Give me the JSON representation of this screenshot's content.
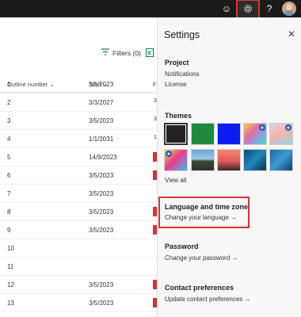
{
  "topbar": {
    "icons": [
      "smiley-icon",
      "gear-icon",
      "help-icon",
      "avatar"
    ],
    "help_label": "?",
    "smiley_label": "☺"
  },
  "grid": {
    "filters_label": "Filters (0)",
    "columns": [
      "Outline number",
      "Start",
      "F"
    ],
    "rows": [
      {
        "num": "1",
        "start": "3/5/2023",
        "extra": "",
        "flag": false
      },
      {
        "num": "2",
        "start": "3/3/2027",
        "extra": "3",
        "flag": false
      },
      {
        "num": "3",
        "start": "3/5/2023",
        "extra": "3",
        "flag": false
      },
      {
        "num": "4",
        "start": "1/1/2031",
        "extra": "1",
        "flag": false
      },
      {
        "num": "5",
        "start": "14/9/2023",
        "extra": "",
        "flag": true
      },
      {
        "num": "6",
        "start": "3/5/2023",
        "extra": "",
        "flag": true
      },
      {
        "num": "7",
        "start": "3/5/2023",
        "extra": "",
        "flag": false
      },
      {
        "num": "8",
        "start": "3/5/2023",
        "extra": "",
        "flag": true
      },
      {
        "num": "9",
        "start": "3/5/2023",
        "extra": "",
        "flag": true
      },
      {
        "num": "10",
        "start": "",
        "extra": "",
        "flag": false
      },
      {
        "num": "11",
        "start": "",
        "extra": "",
        "flag": false
      },
      {
        "num": "12",
        "start": "3/5/2023",
        "extra": "",
        "flag": true
      },
      {
        "num": "13",
        "start": "3/5/2023",
        "extra": "",
        "flag": true
      }
    ]
  },
  "settings": {
    "title": "Settings",
    "project": {
      "title": "Project",
      "items": [
        "Notifications",
        "License"
      ]
    },
    "themes": {
      "title": "Themes",
      "view_all": "View all"
    },
    "language": {
      "title": "Language and time zone",
      "link": "Change your language →"
    },
    "password": {
      "title": "Password",
      "link": "Change your password →"
    },
    "contact": {
      "title": "Contact preferences",
      "link": "Update contact preferences →"
    }
  },
  "colors": {
    "accent_red": "#e03232",
    "topbar": "#1b1b1b",
    "flag_red": "#d13438"
  }
}
